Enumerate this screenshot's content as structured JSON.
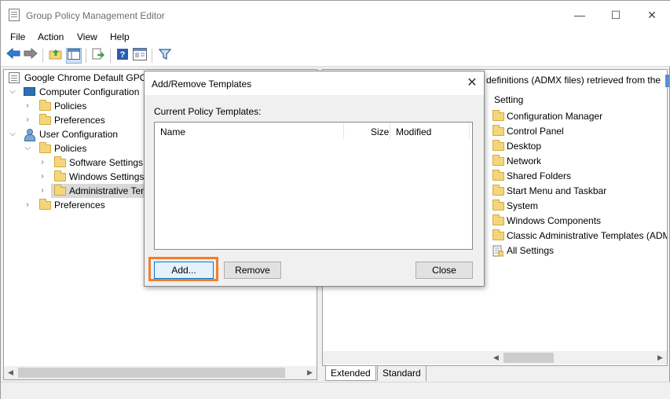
{
  "window": {
    "title": "Group Policy Management Editor",
    "minimize_glyph": "—",
    "maximize_glyph": "☐",
    "close_glyph": "✕"
  },
  "menu": [
    "File",
    "Action",
    "View",
    "Help"
  ],
  "toolbar": {
    "icons": [
      "back-arrow-icon",
      "forward-arrow-icon",
      "up-folder-icon",
      "show-hide-tree-icon",
      "export-list-icon",
      "help-icon",
      "properties-icon",
      "filter-icon"
    ]
  },
  "tree": {
    "root": "Google Chrome Default GPO",
    "computer_config": "Computer Configuration",
    "cc_policies": "Policies",
    "cc_preferences": "Preferences",
    "user_config": "User Configuration",
    "uc_policies": "Policies",
    "software_settings": "Software Settings",
    "windows_settings": "Windows Settings",
    "admin_templates": "Administrative Templates",
    "uc_preferences": "Preferences"
  },
  "right_pane": {
    "description_fragment": "definitions (ADMX files) retrieved from the",
    "column_header": "Setting",
    "items": [
      "Configuration Manager",
      "Control Panel",
      "Desktop",
      "Network",
      "Shared Folders",
      "Start Menu and Taskbar",
      "System",
      "Windows Components",
      "Classic Administrative Templates (ADM",
      "All Settings"
    ]
  },
  "tabs": [
    "Extended",
    "Standard"
  ],
  "dialog": {
    "title": "Add/Remove Templates",
    "list_label": "Current Policy Templates:",
    "columns": {
      "name": "Name",
      "size": "Size",
      "modified": "Modified"
    },
    "buttons": {
      "add": "Add...",
      "remove": "Remove",
      "close": "Close"
    },
    "highlight_color": "#f47d2a"
  }
}
